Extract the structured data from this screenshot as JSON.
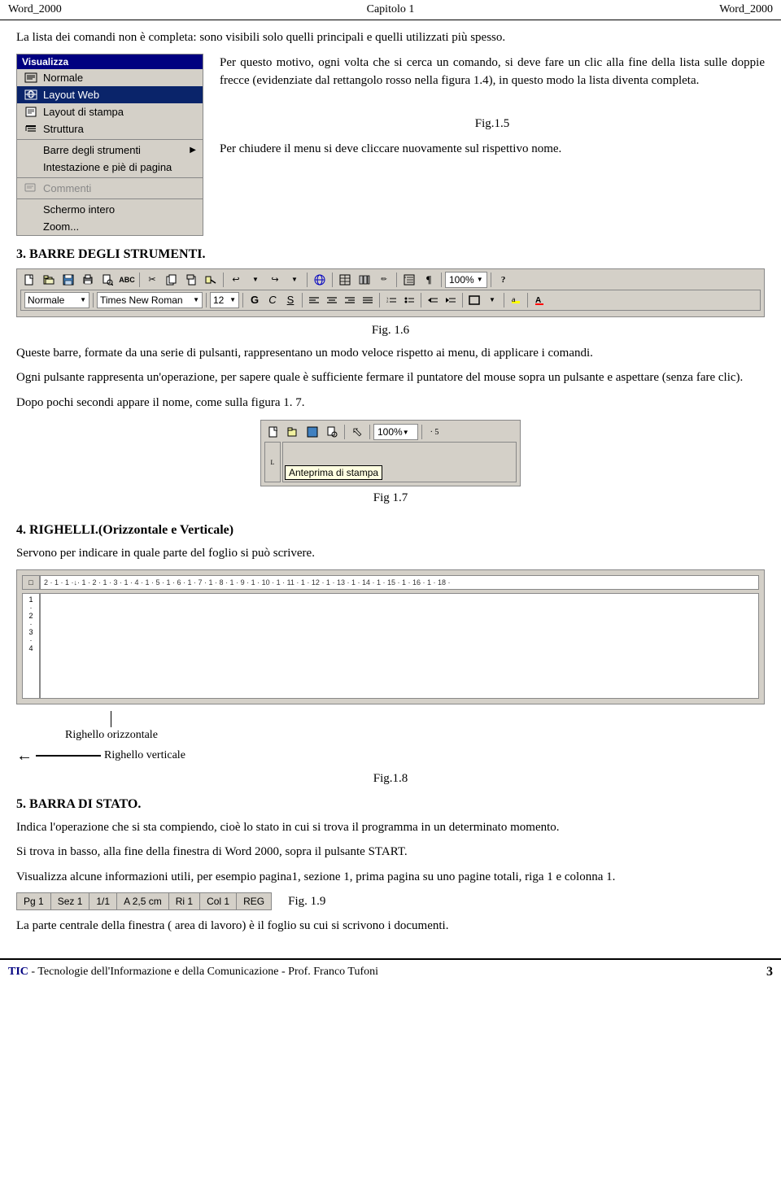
{
  "header": {
    "left": "Word_2000",
    "center": "Capitolo 1",
    "right": "Word_2000"
  },
  "intro": {
    "text": "La lista dei comandi non è completa: sono visibili solo quelli principali e quelli utilizzati più spesso."
  },
  "para1": {
    "text": "Per questo motivo, ogni volta che si cerca un comando, si deve fare un clic alla fine della lista sulle doppie frecce (evidenziate dal rettangolo rosso nella figura 1.4), in questo modo la lista diventa completa."
  },
  "menu": {
    "title": "Visualizza",
    "items": [
      {
        "label": "Normale",
        "icon": "doc",
        "hasIcon": true
      },
      {
        "label": "Layout Web",
        "icon": "web",
        "hasIcon": true,
        "highlighted": true
      },
      {
        "label": "Layout di stampa",
        "icon": "print",
        "hasIcon": true
      },
      {
        "label": "Struttura",
        "icon": "struct",
        "hasIcon": true
      },
      {
        "separator": true
      },
      {
        "label": "Barre degli strumenti",
        "icon": "",
        "hasArrow": true
      },
      {
        "label": "Intestazione e piè di pagina",
        "icon": ""
      },
      {
        "separator": true
      },
      {
        "label": "Commenti",
        "icon": "comment",
        "hasIcon": true,
        "grayed": true
      },
      {
        "separator": true
      },
      {
        "label": "Schermo intero",
        "icon": ""
      },
      {
        "label": "Zoom...",
        "icon": ""
      }
    ]
  },
  "fig15": {
    "caption": "Fig.1.5",
    "text": "Per chiudere il menu si deve cliccare nuovamente sul rispettivo nome."
  },
  "section3": {
    "heading": "3.  BARRE DEGLI STRUMENTI.",
    "fig16_caption": "Fig. 1.6",
    "fig16_text1": "Queste barre, formate da una serie di pulsanti, rappresentano un modo veloce rispetto ai menu, di applicare i comandi.",
    "fig16_text2": "Ogni pulsante rappresenta un'operazione, per sapere quale è sufficiente fermare il puntatore del mouse sopra un pulsante e aspettare (senza fare clic).",
    "fig16_text3": "Dopo pochi secondi appare il nome, come sulla figura 1. 7."
  },
  "toolbar": {
    "row1_buttons": [
      "🗋",
      "📂",
      "💾",
      "🖨",
      "🔍",
      "✂",
      "📋",
      "🗐",
      "↩",
      "↪",
      "🌐",
      "📊",
      "📝",
      "📋",
      "📊",
      "¶",
      "100%",
      "?"
    ],
    "row2_style": "Normale",
    "row2_font": "Times New Roman",
    "row2_size": "12",
    "row2_bold": "G",
    "row2_italic": "C",
    "row2_underline": "S"
  },
  "fig17": {
    "caption": "Fig 1.7",
    "tooltip": "Anteprima di stampa"
  },
  "section4": {
    "heading": "4.  RIGHELLI.(Orizzontale e Verticale)",
    "text": "Servono per indicare in quale parte del foglio si può scrivere.",
    "righello_orizz_label": "Righello orizzontale",
    "righello_vert_label": "Righello verticale",
    "fig18_caption": "Fig.1.8"
  },
  "section5": {
    "heading": "5.  BARRA DI STATO.",
    "text1": "Indica l'operazione che si sta compiendo, cioè lo stato in cui si trova il programma in un determinato momento.",
    "text2": "Si trova in basso, alla fine della finestra di Word 2000, sopra il pulsante START.",
    "text3": "Visualizza alcune informazioni utili, per esempio pagina1, sezione 1, prima pagina su uno pagine totali, riga 1 e colonna 1.",
    "statusbar": {
      "cells": [
        "Pg 1",
        "Sez 1",
        "1/1",
        "A 2,5 cm",
        "Ri 1",
        "Col 1",
        "REG"
      ]
    },
    "fig19_caption": "Fig. 1.9",
    "closing_text": "La parte centrale della finestra ( area di lavoro) è il foglio su cui si scrivono i documenti."
  },
  "footer": {
    "tic": "TIC",
    "middle": " - Tecnologie dell'Informazione e della Comunicazione  -  Prof. Franco Tufoni",
    "page": "3"
  }
}
